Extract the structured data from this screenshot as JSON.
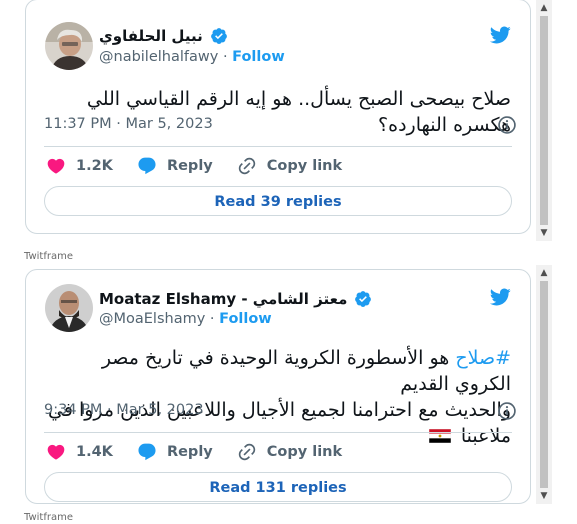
{
  "tweets": [
    {
      "display_name": "نبيل الحلفاوي",
      "handle": "@nabilelhalfawy",
      "separator": "·",
      "follow_label": "Follow",
      "text": "صلاح بيصحى الصبح يسأل.. هو إيه الرقم القياسي اللي هكسره النهارده؟",
      "timestamp": "11:37 PM · Mar 5, 2023",
      "likes": "1.2K",
      "reply_label": "Reply",
      "copy_label": "Copy link",
      "read_replies": "Read 39 replies"
    },
    {
      "display_name": "Moataz Elshamy - معتز الشامي",
      "handle": "@MoaElshamy",
      "separator": "·",
      "follow_label": "Follow",
      "hashtag": "#صلاح",
      "text_line1": " هو الأسطورة الكروية الوحيدة في تاريخ مصر الكروي القديم",
      "text_line2": "والحديث  مع احترامنا لجميع الأجيال واللاعبين الذين مروا في ملاعبنا",
      "flag_emoji": "🇪🇬",
      "timestamp": "9:34 PM · Mar 5, 2023",
      "likes": "1.4K",
      "reply_label": "Reply",
      "copy_label": "Copy link",
      "read_replies": "Read 131 replies"
    }
  ],
  "twitframe_label": "Twitframe",
  "icons": {
    "brand": "twitter-bird-icon",
    "verified": "verified-badge-icon",
    "info": "info-icon",
    "like": "heart-icon",
    "reply": "speech-bubble-icon",
    "copy": "link-icon"
  },
  "colors": {
    "accent": "#1d9bf0",
    "heart": "#f91880",
    "muted": "#536471",
    "border": "#cfd9de"
  }
}
